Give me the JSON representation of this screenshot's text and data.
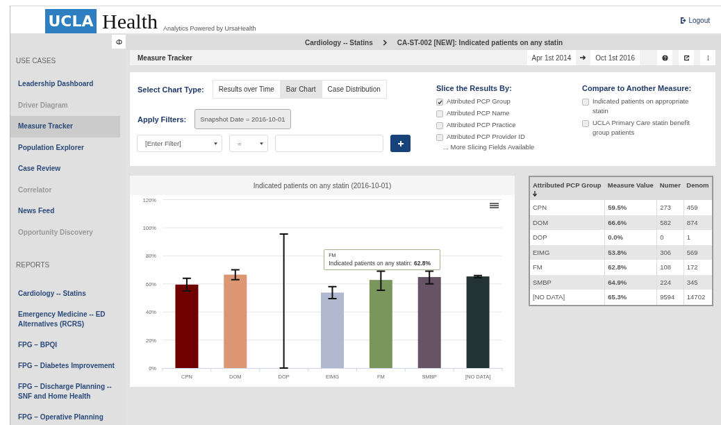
{
  "header": {
    "logo_box": "UCLA",
    "logo_word": "Health",
    "tagline": "Analytics Powered by UrsaHealth",
    "logout": "Logout"
  },
  "sidebar": {
    "sections": [
      {
        "heading": "USE CASES",
        "items": [
          {
            "label": "Leadership Dashboard",
            "selected": false,
            "disabled": false
          },
          {
            "label": "Driver Diagram",
            "selected": false,
            "disabled": true
          },
          {
            "label": "Measure Tracker",
            "selected": true,
            "disabled": false
          },
          {
            "label": "Population Explorer",
            "selected": false,
            "disabled": false
          },
          {
            "label": "Case Review",
            "selected": false,
            "disabled": false
          },
          {
            "label": "Correlator",
            "selected": false,
            "disabled": true
          },
          {
            "label": "News Feed",
            "selected": false,
            "disabled": false
          },
          {
            "label": "Opportunity Discovery",
            "selected": false,
            "disabled": true
          }
        ]
      },
      {
        "heading": "REPORTS",
        "items": [
          {
            "label": "Cardiology -- Statins",
            "selected": false,
            "disabled": false
          },
          {
            "label": "Emergency Medicine -- ED Alternatives (RCRS)",
            "selected": false,
            "disabled": false
          },
          {
            "label": "FPG – BPQI",
            "selected": false,
            "disabled": false
          },
          {
            "label": "FPG – Diabetes Improvement",
            "selected": false,
            "disabled": false
          },
          {
            "label": "FPG – Discharge Planning -- SNF and Home Health",
            "selected": false,
            "disabled": false
          },
          {
            "label": "FPG – Operative Planning",
            "selected": false,
            "disabled": false
          }
        ]
      }
    ]
  },
  "breadcrumb": [
    "Cardiology -- Statins",
    "CA-ST-002 [NEW]: Indicated patients on any statin"
  ],
  "toolbar": {
    "title": "Measure Tracker",
    "date_from": "Apr 1st 2014",
    "date_to": "Oct 1st 2016"
  },
  "chart_type": {
    "label": "Select Chart Type:",
    "options": [
      {
        "label": "Results over Time",
        "selected": false
      },
      {
        "label": "Bar Chart",
        "selected": true
      },
      {
        "label": "Case Distribution",
        "selected": false
      }
    ]
  },
  "filters": {
    "label": "Apply Filters:",
    "chips": [
      "Snapshot Date = 2016-10-01"
    ],
    "field": "[Enter Filter]",
    "operator": "="
  },
  "slice": {
    "title": "Slice the Results By:",
    "options": [
      {
        "label": "Attributed PCP Group",
        "checked": true
      },
      {
        "label": "Attributed PCP Name",
        "checked": false
      },
      {
        "label": "Attributed PCP Practice",
        "checked": false
      },
      {
        "label": "Attributed PCP Provider ID",
        "checked": false
      }
    ],
    "more": "... More Slicing Fields Available"
  },
  "compare": {
    "title": "Compare to Another Measure:",
    "options": [
      {
        "label": "Indicated patients on appropriate statin",
        "checked": false
      },
      {
        "label": "UCLA Primary Care statin benefit group patients",
        "checked": false
      }
    ]
  },
  "chart": {
    "title": "Indicated patients on any statin (2016-10-01)",
    "chart_data": {
      "type": "bar",
      "categories": [
        "CPN",
        "DOM",
        "DOP",
        "EIMG",
        "FM",
        "SMBP",
        "[NO DATA]"
      ],
      "series": [
        {
          "values": [
            59.5,
            66.6,
            0,
            53.8,
            62.8,
            64.9,
            65.3
          ],
          "errors": [
            [
              55,
              64
            ],
            [
              63,
              70
            ],
            [
              0,
              95.5
            ],
            [
              49.5,
              58
            ],
            [
              55.5,
              69
            ],
            [
              60,
              69
            ],
            [
              64.5,
              66
            ]
          ]
        }
      ],
      "colors": [
        "#700000",
        "#dc9673",
        null,
        "#b0b9cf",
        "#7a965d",
        "#665366",
        "#233333"
      ],
      "grid": true,
      "ylim": [
        0,
        120
      ],
      "yticks": [
        {
          "value": 0,
          "label": "0%"
        },
        {
          "value": 20,
          "label": "20%"
        },
        {
          "value": 40,
          "label": "40%"
        },
        {
          "value": 60,
          "label": "60%"
        },
        {
          "value": 80,
          "label": "80%"
        },
        {
          "value": 100,
          "label": "100%"
        },
        {
          "value": 120,
          "label": "120%"
        }
      ]
    },
    "tooltip": {
      "category": "FM",
      "label": "Indicated patients on any statin:",
      "value": "62.8%"
    }
  },
  "table": {
    "columns": [
      {
        "label": "Attributed PCP Group",
        "sorted": true
      },
      {
        "label": "Measure Value",
        "sorted": false
      },
      {
        "label": "Numer",
        "sorted": false
      },
      {
        "label": "Denom",
        "sorted": false
      }
    ],
    "rows": [
      [
        "CPN",
        "59.5%",
        "273",
        "459"
      ],
      [
        "DOM",
        "66.6%",
        "582",
        "874"
      ],
      [
        "DOP",
        "0.0%",
        "0",
        "1"
      ],
      [
        "EIMG",
        "53.8%",
        "306",
        "569"
      ],
      [
        "FM",
        "62.8%",
        "108",
        "172"
      ],
      [
        "SMBP",
        "64.9%",
        "224",
        "345"
      ],
      [
        "[NO DATA]",
        "65.3%",
        "9594",
        "14702"
      ]
    ]
  }
}
